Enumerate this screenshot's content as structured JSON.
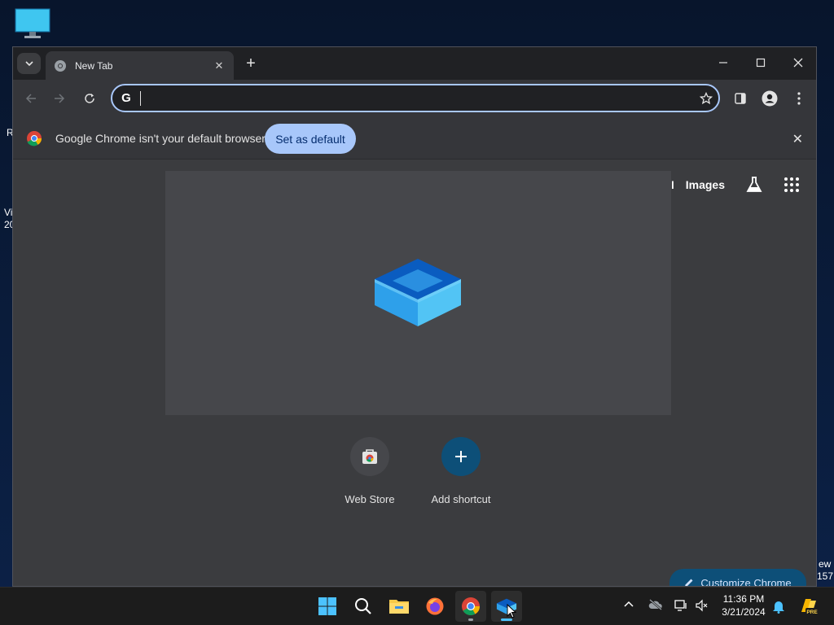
{
  "desktop": {
    "frag_r": "R",
    "frag_vi": "Vi",
    "frag_20": "20",
    "frag_ew": "ew",
    "frag_157": "157"
  },
  "browser": {
    "tab_title": "New Tab",
    "omnibox_value": "",
    "infobar": {
      "message": "Google Chrome isn't your default browser",
      "button": "Set as default"
    },
    "top_links": {
      "mail": "il",
      "images": "Images"
    },
    "shortcuts": [
      {
        "label": "Web Store"
      },
      {
        "label": "Add shortcut"
      }
    ],
    "customize_label": "Customize Chrome"
  },
  "taskbar": {
    "time": "11:36 PM",
    "date": "3/21/2024",
    "pre_badge": "PRE"
  },
  "colors": {
    "accent": "#a8c7fa",
    "titlebar": "#202124",
    "toolbar": "#35363a",
    "content_bg": "#3b3c3f",
    "customize_bg": "#0d4f78"
  }
}
